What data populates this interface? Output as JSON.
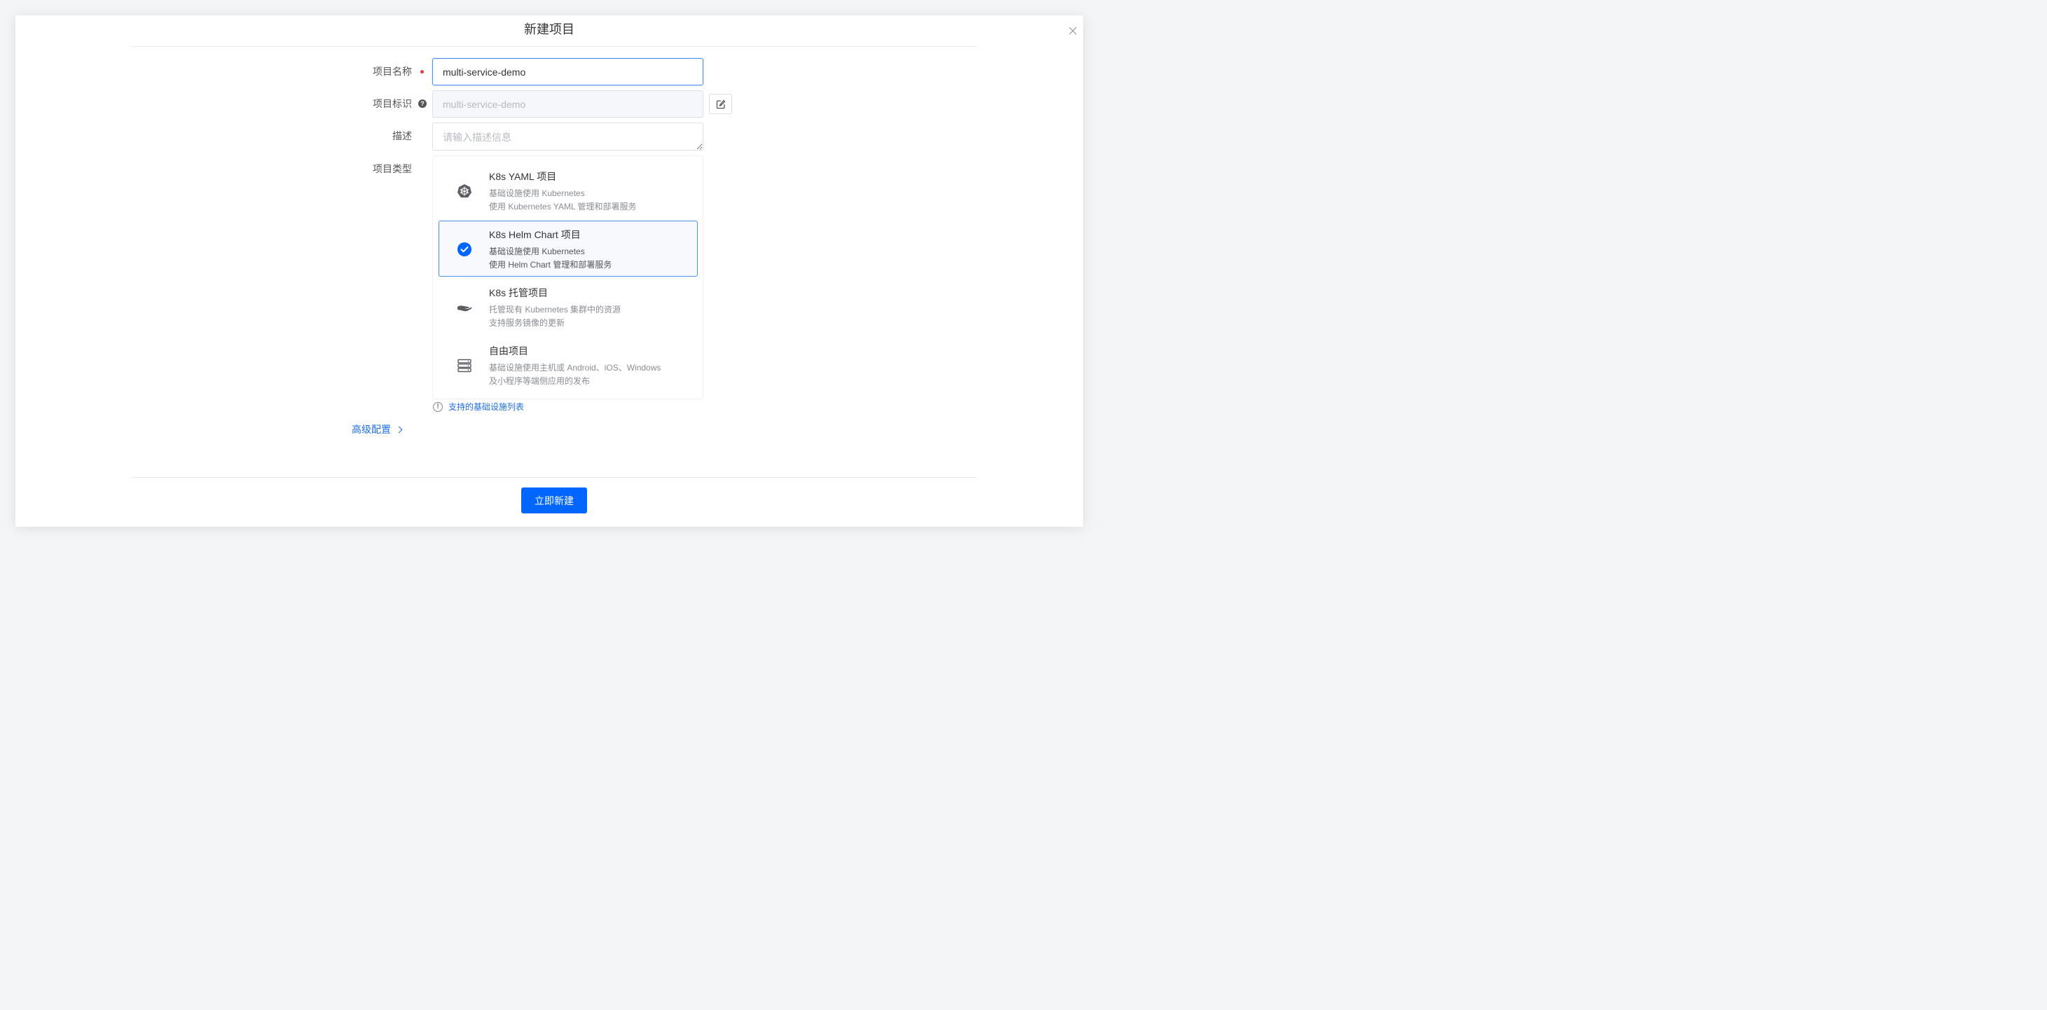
{
  "modal": {
    "title": "新建项目",
    "submit_label": "立即新建"
  },
  "form": {
    "name": {
      "label": "项目名称",
      "value": "multi-service-demo"
    },
    "identifier": {
      "label": "项目标识",
      "value": "multi-service-demo",
      "help_icon": "?"
    },
    "description": {
      "label": "描述",
      "placeholder": "请输入描述信息"
    },
    "type": {
      "label": "项目类型",
      "options": [
        {
          "icon": "kubernetes-icon",
          "title": "K8s YAML 项目",
          "desc1": "基础设施使用 Kubernetes",
          "desc2": "使用 Kubernetes YAML 管理和部署服务",
          "selected": false
        },
        {
          "icon": "check-circle-icon",
          "title": "K8s Helm Chart 项目",
          "desc1": "基础设施使用 Kubernetes",
          "desc2": "使用 Helm Chart 管理和部署服务",
          "selected": true
        },
        {
          "icon": "hand-icon",
          "title": "K8s 托管项目",
          "desc1": "托管现有 Kubernetes 集群中的资源",
          "desc2": "支持服务镜像的更新",
          "selected": false
        },
        {
          "icon": "server-icon",
          "title": "自由项目",
          "desc1": "基础设施使用主机或 Android、iOS、Windows",
          "desc2": "及小程序等端侧应用的发布",
          "selected": false
        }
      ]
    },
    "infra_link": "支持的基础设施列表",
    "info_icon": "!",
    "advanced": "高级配置"
  },
  "colors": {
    "primary": "#0066ff",
    "link": "#1f6fe5",
    "required": "#e4393c",
    "selected_border": "#4d8ff0"
  }
}
